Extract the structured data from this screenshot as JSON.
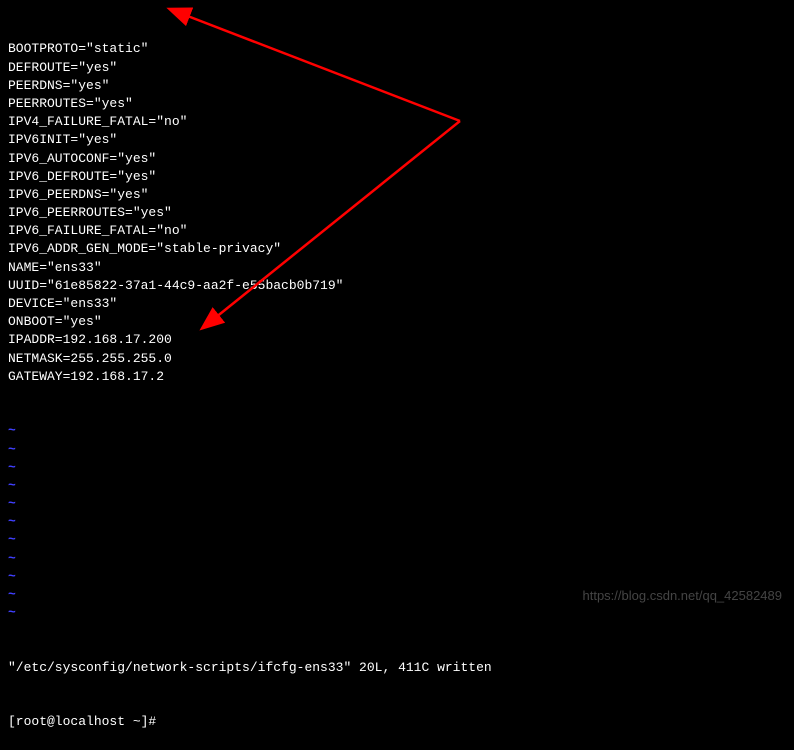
{
  "config_lines": [
    "BOOTPROTO=\"static\"",
    "DEFROUTE=\"yes\"",
    "PEERDNS=\"yes\"",
    "PEERROUTES=\"yes\"",
    "IPV4_FAILURE_FATAL=\"no\"",
    "IPV6INIT=\"yes\"",
    "IPV6_AUTOCONF=\"yes\"",
    "IPV6_DEFROUTE=\"yes\"",
    "IPV6_PEERDNS=\"yes\"",
    "IPV6_PEERROUTES=\"yes\"",
    "IPV6_FAILURE_FATAL=\"no\"",
    "IPV6_ADDR_GEN_MODE=\"stable-privacy\"",
    "NAME=\"ens33\"",
    "UUID=\"61e85822-37a1-44c9-aa2f-e55bacb0b719\"",
    "DEVICE=\"ens33\"",
    "ONBOOT=\"yes\"",
    "IPADDR=192.168.17.200",
    "NETMASK=255.255.255.0",
    "GATEWAY=192.168.17.2"
  ],
  "tilde_count": 11,
  "tilde_char": "~",
  "status_message": "\"/etc/sysconfig/network-scripts/ifcfg-ens33\" 20L, 411C written",
  "prompt": "[root@localhost ~]#",
  "watermark": "https://blog.csdn.net/qq_42582489"
}
